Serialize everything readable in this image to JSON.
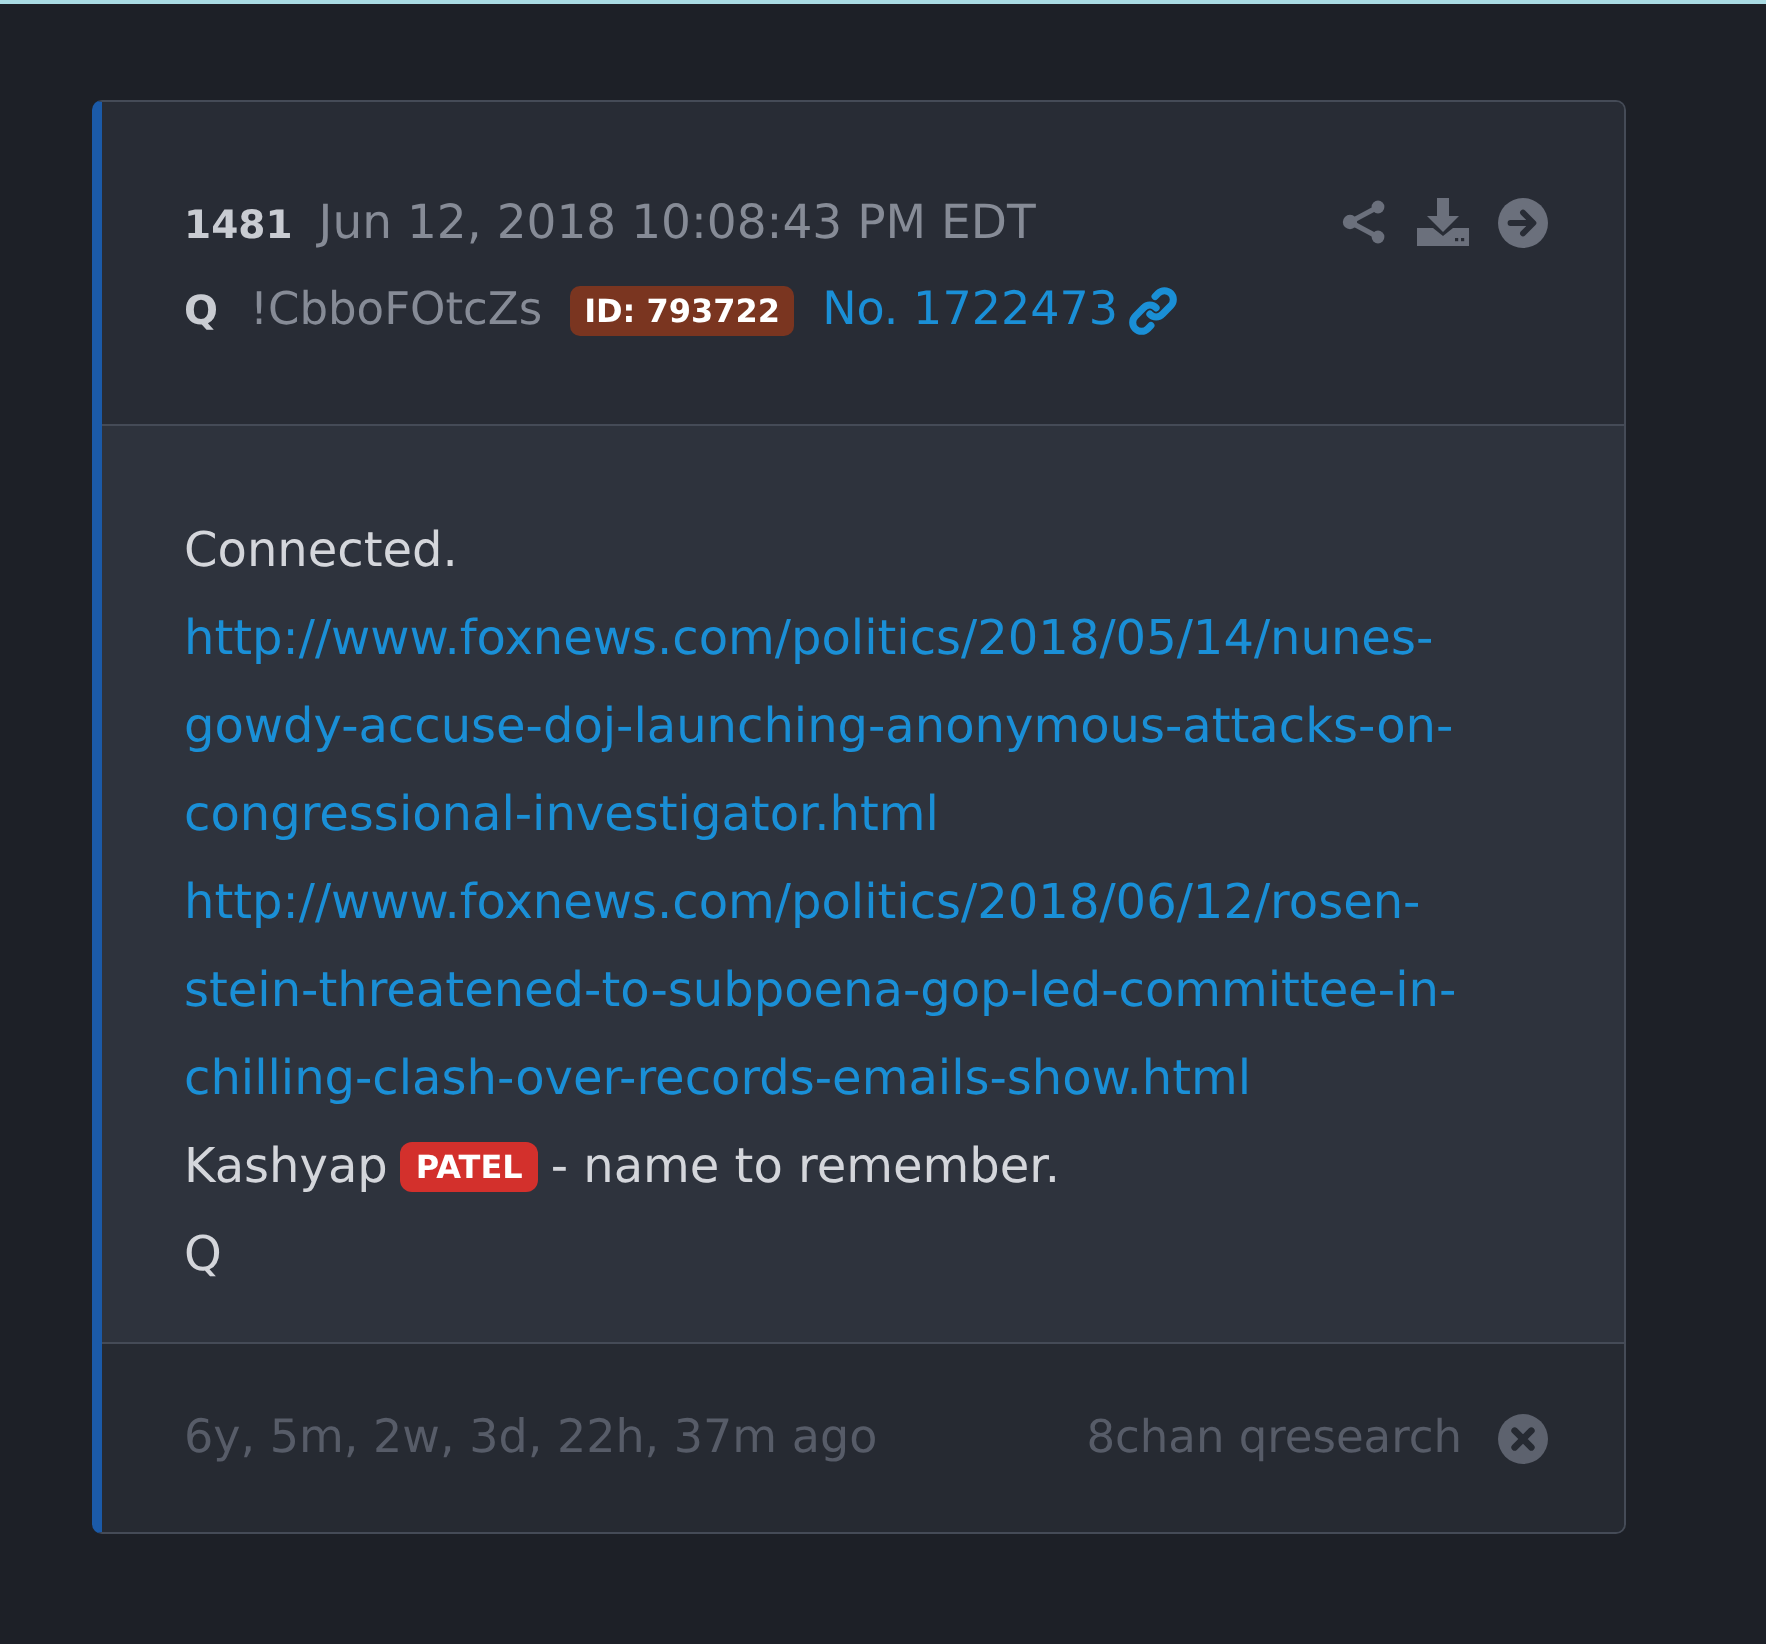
{
  "post": {
    "number": "1481",
    "date": "Jun 12, 2018 10:08:43 PM EDT",
    "author": "Q",
    "tripcode": "!CbboFOtcZs",
    "id_badge": "ID: 793722",
    "post_link": "No. 1722473",
    "body": [
      {
        "segments": [
          {
            "kind": "text",
            "text": "Connected."
          }
        ]
      },
      {
        "segments": [
          {
            "kind": "link",
            "text": "http://www.foxnews.com/politics/2018/05/14/nunes-gowdy-accuse-doj-launching-anonymous-attacks-on-congressional-investigator.html"
          }
        ]
      },
      {
        "segments": [
          {
            "kind": "link",
            "text": "http://www.foxnews.com/politics/2018/06/12/rosen-stein-threatened-to-subpoena-gop-led-committee-in-chilling-clash-over-records-emails-show.html"
          }
        ]
      },
      {
        "segments": [
          {
            "kind": "text",
            "text": "Kashyap"
          },
          {
            "kind": "highlight",
            "text": "PATEL"
          },
          {
            "kind": "text",
            "text": "- name to remember."
          }
        ]
      },
      {
        "segments": [
          {
            "kind": "text",
            "text": "Q"
          }
        ]
      }
    ],
    "age": "6y, 5m, 2w, 3d, 22h, 37m ago",
    "source": "8chan qresearch"
  }
}
